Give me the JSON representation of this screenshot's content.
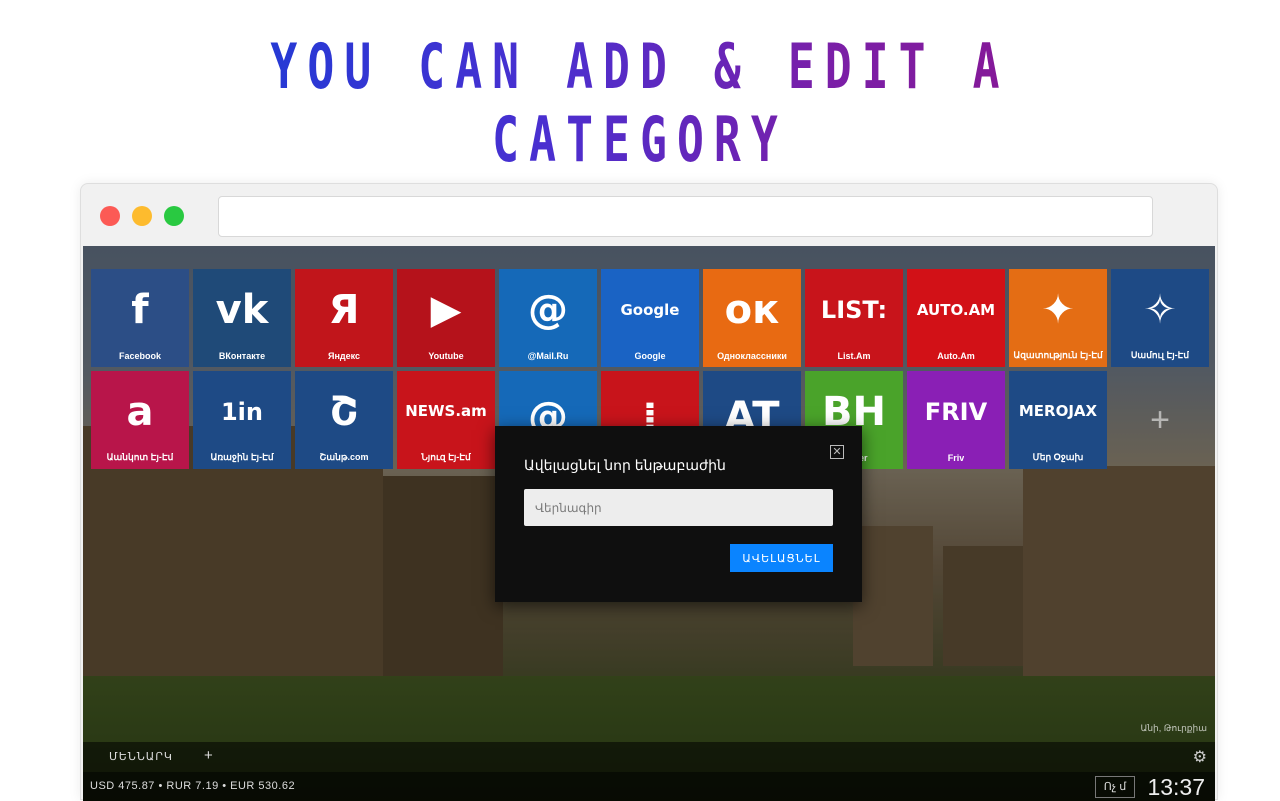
{
  "headline": "YOU CAN ADD & EDIT A CATEGORY",
  "tiles": [
    {
      "label": "Facebook",
      "icon": "f",
      "color": "#2c4e86"
    },
    {
      "label": "ВКонтакте",
      "icon": "vk",
      "color": "#1f4a78"
    },
    {
      "label": "Яндекс",
      "icon": "Я",
      "color": "#c1151b"
    },
    {
      "label": "Youtube",
      "icon": "▶",
      "color": "#b5121b"
    },
    {
      "label": "@Mail.Ru",
      "icon": "@",
      "color": "#1569b8"
    },
    {
      "label": "Google",
      "icon": "Google",
      "color": "#1a63c4"
    },
    {
      "label": "Одноклассники",
      "icon": "ок",
      "color": "#e86a12"
    },
    {
      "label": "List.Am",
      "icon": "LIST:",
      "color": "#c8141b"
    },
    {
      "label": "Auto.Am",
      "icon": "AUTO.AM",
      "color": "#d21117"
    },
    {
      "label": "Ազատություն Էյ-Էմ",
      "icon": "✦",
      "color": "#e46d14"
    },
    {
      "label": "Սամուլ Էյ-Էմ",
      "icon": "✧",
      "color": "#1e4a85"
    },
    {
      "label": "Աանկոտ Էյ-Էմ",
      "icon": "a",
      "color": "#b8154a"
    },
    {
      "label": "Առաջին Էյ-Էմ",
      "icon": "1in",
      "color": "#1e4a85"
    },
    {
      "label": "Շանթ.com",
      "icon": "Շ",
      "color": "#1e4a85"
    },
    {
      "label": "Նյուզ Էյ-Էմ",
      "icon": "NEWS.am",
      "color": "#c8141b"
    },
    {
      "label": "",
      "icon": "@",
      "color": "#1569b8"
    },
    {
      "label": "",
      "icon": "⁞",
      "color": "#c8141b"
    },
    {
      "label": "",
      "icon": "AT",
      "color": "#1e4a85"
    },
    {
      "label": "Player",
      "icon": "BH",
      "color": "#4aa32a"
    },
    {
      "label": "Friv",
      "icon": "FRIV",
      "color": "#8a1fb5"
    },
    {
      "label": "Մեր Օջախ",
      "icon": "MEROJAX",
      "color": "#1e4a85"
    }
  ],
  "add_tile_label": "+",
  "modal": {
    "title": "Ավելացնել նոր ենթաբաժին",
    "placeholder": "Վերնագիր",
    "button_label": "ԱՎԵԼԱՑՆԵԼ",
    "close_label": "✕"
  },
  "photo_caption": "Անի, Թուրքիա",
  "bottombar": {
    "menu_tab": "ՄԵՆՆԱՐԿ",
    "add_tab": "+",
    "settings_icon": "gear-icon"
  },
  "status": {
    "rates": "USD 475.87 • RUR 7.19 • EUR 530.62",
    "weather": "Ոչ մ",
    "time": "13:37"
  }
}
